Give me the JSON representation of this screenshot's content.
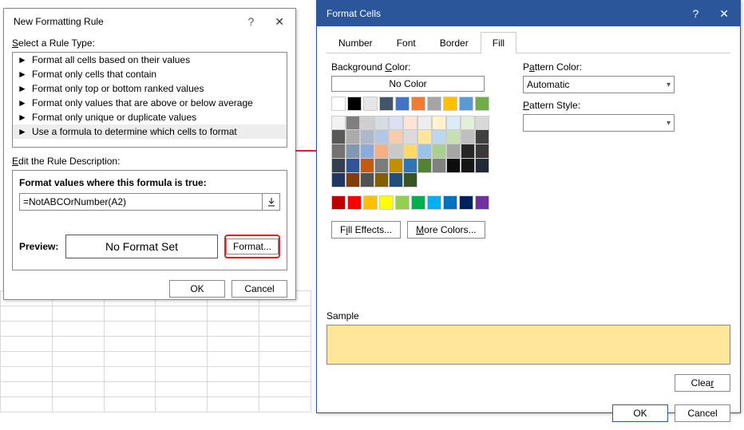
{
  "nfr": {
    "title": "New Formatting Rule",
    "select_label": "Select a Rule Type:",
    "rules": [
      "Format all cells based on their values",
      "Format only cells that contain",
      "Format only top or bottom ranked values",
      "Format only values that are above or below average",
      "Format only unique or duplicate values",
      "Use a formula to determine which cells to format"
    ],
    "edit_label": "Edit the Rule Description:",
    "formula_heading": "Format values where this formula is true:",
    "formula_value": "=NotABCOrNumber(A2)",
    "preview_label": "Preview:",
    "preview_text": "No Format Set",
    "format_btn": "Format...",
    "ok": "OK",
    "cancel": "Cancel"
  },
  "fc": {
    "title": "Format Cells",
    "tabs": [
      "Number",
      "Font",
      "Border",
      "Fill"
    ],
    "active_tab": "Fill",
    "bg_label": "Background Color:",
    "no_color": "No Color",
    "pattern_color_label": "Pattern Color:",
    "pattern_color_value": "Automatic",
    "pattern_style_label": "Pattern Style:",
    "fill_effects": "Fill Effects...",
    "more_colors": "More Colors...",
    "sample_label": "Sample",
    "sample_color": "#ffe699",
    "clear": "Clear",
    "ok": "OK",
    "cancel": "Cancel",
    "theme_colors_row": [
      "#ffffff",
      "#000000",
      "#e7e6e6",
      "#44546a",
      "#4472c4",
      "#ed7d31",
      "#a5a5a5",
      "#ffc000",
      "#5b9bd5",
      "#70ad47"
    ],
    "shade_rows": [
      [
        "#f2f2f2",
        "#7f7f7f",
        "#d0cece",
        "#d6dce4",
        "#d9e1f2",
        "#fce4d6",
        "#ededed",
        "#fff2cc",
        "#ddebf7",
        "#e2efda"
      ],
      [
        "#d9d9d9",
        "#595959",
        "#aeaaaa",
        "#acb9ca",
        "#b4c6e7",
        "#f8cbad",
        "#dbdbdb",
        "#ffe699",
        "#bdd7ee",
        "#c6e0b4"
      ],
      [
        "#bfbfbf",
        "#404040",
        "#757171",
        "#8497b0",
        "#8ea9db",
        "#f4b084",
        "#c9c9c9",
        "#ffd966",
        "#9bc2e6",
        "#a9d08e"
      ],
      [
        "#a6a6a6",
        "#262626",
        "#3a3838",
        "#333f4f",
        "#305496",
        "#c65911",
        "#7b7b7b",
        "#bf8f00",
        "#2f75b5",
        "#548235"
      ],
      [
        "#808080",
        "#0d0d0d",
        "#161616",
        "#222b35",
        "#203764",
        "#833c0c",
        "#525252",
        "#806000",
        "#1f4e78",
        "#375623"
      ]
    ],
    "standard_colors": [
      "#c00000",
      "#ff0000",
      "#ffc000",
      "#ffff00",
      "#92d050",
      "#00b050",
      "#00b0f0",
      "#0070c0",
      "#002060",
      "#7030a0"
    ]
  }
}
